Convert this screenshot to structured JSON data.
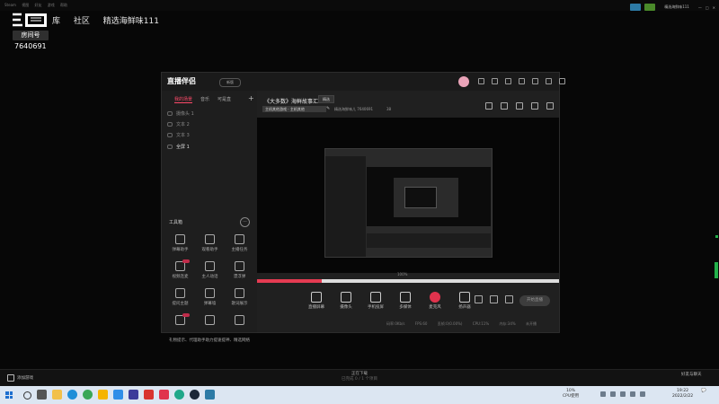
{
  "top_menu": [
    "Steam",
    "视图",
    "好友",
    "游戏",
    "帮助"
  ],
  "brand_text": "三国",
  "steam_nav": [
    "库",
    "社区",
    "精选海鲜味111"
  ],
  "room": {
    "label": "房间号",
    "number": "7640691"
  },
  "top_right_user": "精选海鲜味111",
  "app": {
    "logo": "直播伴侣",
    "version_badge": "新版",
    "left_tabs": [
      "我的场景",
      "音乐",
      "可是直"
    ],
    "add_label": "+",
    "scenes": [
      "摄像头 1",
      "文本 2",
      "文本 3",
      "全屏 1"
    ],
    "tools_title": "工具箱",
    "tools_more": "···",
    "tools": [
      "弹幕助手",
      "观看助手",
      "主播任务",
      "视频连麦",
      "主人动话",
      "漂浮弹",
      "提问主题",
      "弹幕墙",
      "歌词展示",
      "",
      "",
      ""
    ],
    "notice": "礼物提示、代理助手助力提速提神、精选网络",
    "stream_title": "《大多数》海鲜故事汇",
    "stream_tag": "精选",
    "category": "主机其他游戏 · 主机其他",
    "edit_icon": "✎",
    "room_info": "精选海鲜味儿 7640691",
    "viewers": "38",
    "zoom": "100%",
    "controls": [
      "直播屏幕",
      "摄像头",
      "手机投屏",
      "多媒体",
      "麦克风",
      "扬声器"
    ],
    "start_button": "开始直播",
    "status": [
      "码率:0Kb/s",
      "FPS:60",
      "丢帧:0(0.00%)",
      "CPU:11%",
      "内存:34%",
      "未开播"
    ]
  },
  "steam_bottom": {
    "add_game": "添加游戏",
    "download_title": "正在下载",
    "download_sub": "已完成 0 / 1 个项目",
    "friends": "好友与聊天"
  },
  "taskbar": {
    "cpu_value": "10%",
    "cpu_label": "CPU使用",
    "clock_time": "19:22",
    "clock_date": "2022/2/22"
  },
  "colors": {
    "accent": "#ff4a6a",
    "mic": "#e0334d",
    "steam_blue": "#2d7ba6",
    "online_green": "#23b04a"
  }
}
